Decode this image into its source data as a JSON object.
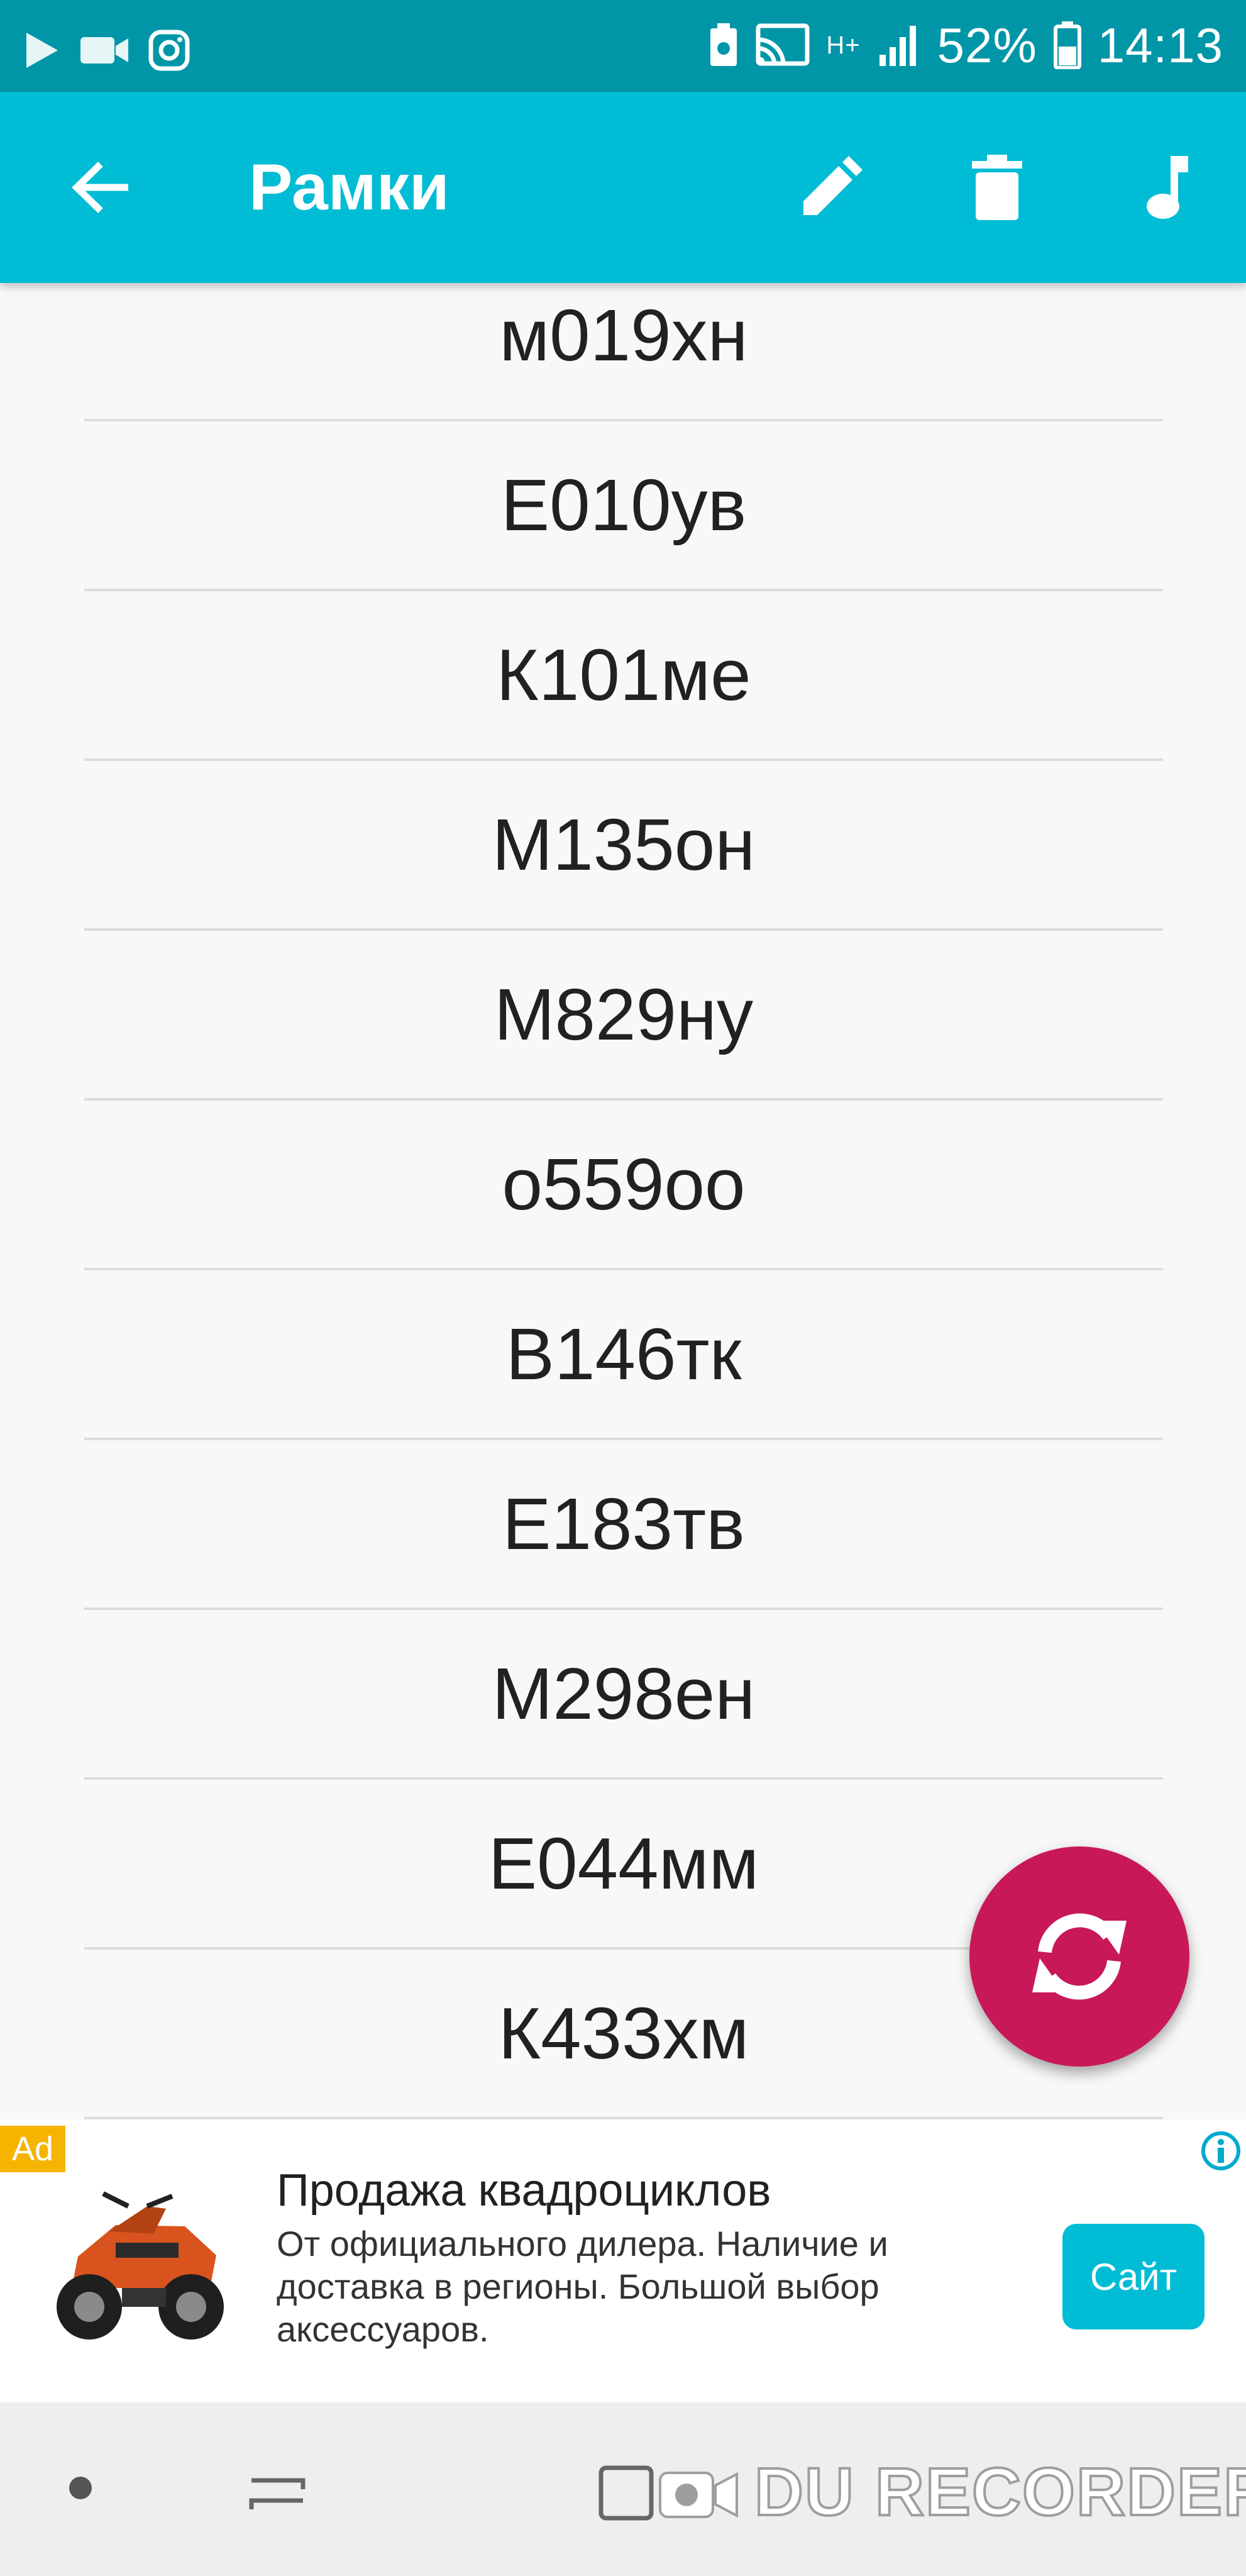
{
  "status_bar": {
    "battery": "52%",
    "time": "14:13",
    "network": "H+",
    "left_icons": [
      "play-icon",
      "video-camera-icon",
      "instagram-icon"
    ],
    "right_icons": [
      "battery-saver-icon",
      "cast-icon",
      "signal-icon",
      "battery-icon"
    ]
  },
  "app_bar": {
    "title": "Рамки",
    "actions": [
      "back-icon",
      "edit-icon",
      "delete-icon",
      "music-icon"
    ]
  },
  "plates": [
    "м019хн",
    "Е010ув",
    "К101ме",
    "М135он",
    "М829ну",
    "о559оо",
    "В146тк",
    "Е183тв",
    "М298ен",
    "Е044мм",
    "К433хм"
  ],
  "fab": {
    "icon": "refresh-icon"
  },
  "ad": {
    "badge": "Ad",
    "title": "Продажа квадроциклов",
    "description": "От официального дилера. Наличие и доставка в регионы. Большой выбор аксессуаров.",
    "cta": "Сайт",
    "image": "atv-image"
  },
  "nav_bar": {
    "watermark": "DU RECORDER"
  },
  "colors": {
    "status_bar": "#0096a7",
    "app_bar": "#00bcd4",
    "fab": "#c8185a",
    "cta": "#00bcd4",
    "ad_badge": "#f5b400"
  }
}
